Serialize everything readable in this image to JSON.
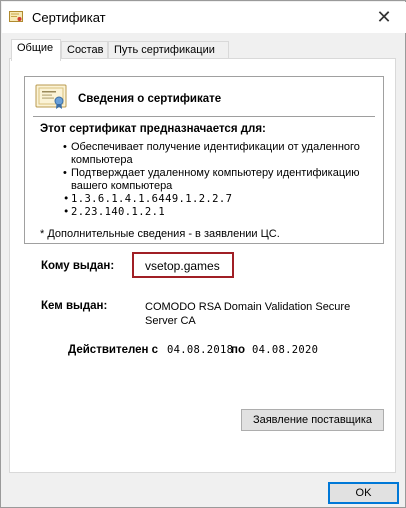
{
  "window": {
    "title": "Сертификат",
    "close_glyph": "✕"
  },
  "tabs": [
    {
      "label": "Общие",
      "active": true
    },
    {
      "label": "Состав",
      "active": false
    },
    {
      "label": "Путь сертификации",
      "active": false
    }
  ],
  "info": {
    "title": "Сведения о сертификате",
    "purpose_header": "Этот сертификат предназначается для:",
    "purposes": [
      "Обеспечивает получение идентификации от удаленного компьютера",
      "Подтверждает удаленному компьютеру идентификацию вашего компьютера",
      "1.3.6.1.4.1.6449.1.2.2.7",
      "2.23.140.1.2.1"
    ],
    "note": "* Дополнительные сведения - в заявлении ЦС."
  },
  "details": {
    "issued_to_label": "Кому выдан:",
    "issued_to_value": "vsetop.games",
    "issued_by_label": "Кем выдан:",
    "issued_by_value": "COMODO RSA Domain Validation Secure Server CA",
    "valid_from_label": "Действителен с",
    "valid_from": "04.08.2018",
    "valid_to_label": "по",
    "valid_to": "04.08.2020"
  },
  "buttons": {
    "issuer_statement": "Заявление поставщика",
    "ok": "OK"
  },
  "colors": {
    "highlight_border": "#a01f25",
    "default_button_border": "#0078d7"
  }
}
